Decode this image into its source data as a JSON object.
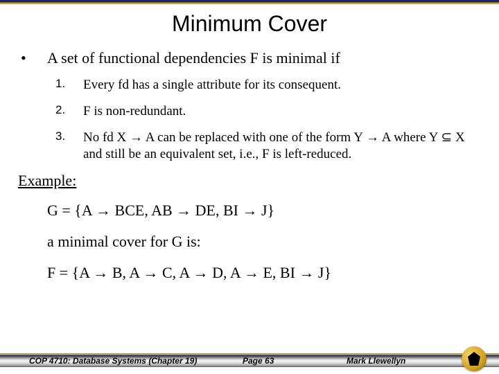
{
  "title": "Minimum Cover",
  "bullet_text": "A set of functional dependencies F is minimal if",
  "items": [
    {
      "num": "1.",
      "text": "Every fd has a single attribute for its consequent."
    },
    {
      "num": "2.",
      "text": "F is non-redundant."
    },
    {
      "num": "3.",
      "text": "No fd X → A can be replaced with one of the form Y → A where Y ⊆ X and still be an equivalent set, i.e., F is left-reduced."
    }
  ],
  "example_label": "Example:",
  "example_g": "G = {A → BCE,  AB → DE,  BI → J}",
  "example_mid": "a minimal cover for G is:",
  "example_f": "F = {A → B, A → C, A → D, A → E, BI → J}",
  "footer": {
    "left": "COP 4710: Database Systems  (Chapter 19)",
    "center": "Page 63",
    "right": "Mark Llewellyn"
  }
}
